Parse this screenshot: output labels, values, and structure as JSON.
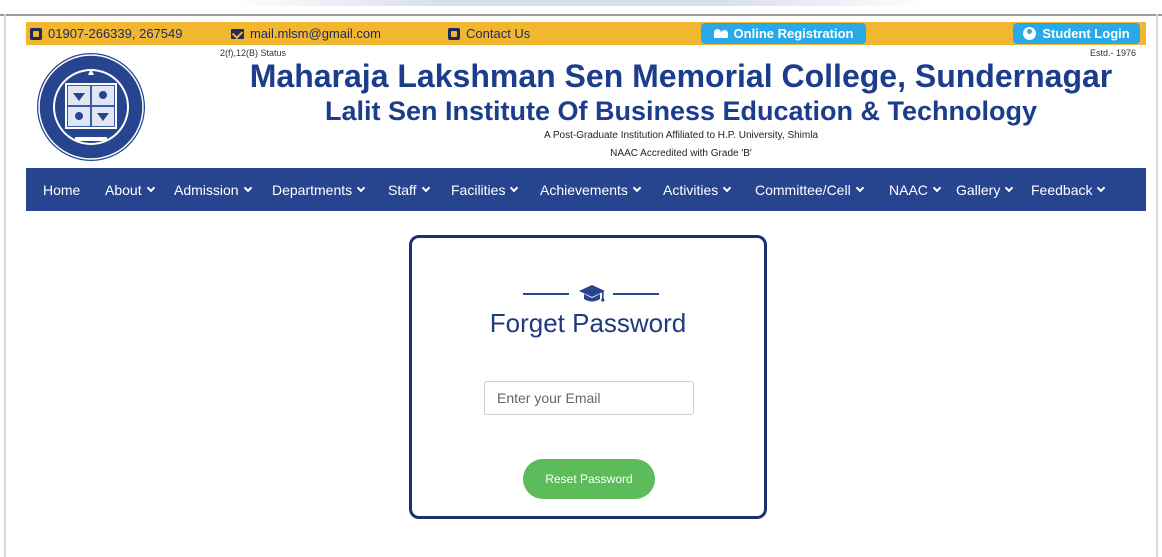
{
  "topbar": {
    "phone": "01907-266339, 267549",
    "email": "mail.mlsm@gmail.com",
    "contact": "Contact Us",
    "registration": "Online Registration",
    "student_login": "Student Login",
    "bg_color": "#f2b730",
    "button_color": "#29a9e8"
  },
  "header": {
    "status": "2(f),12(B) Status",
    "estd": "Estd.- 1976",
    "title": "Maharaja Lakshman Sen Memorial College, Sundernagar",
    "subtitle": "Lalit Sen Institute Of Business Education & Technology",
    "affiliation": "A Post-Graduate Institution Affiliated to H.P. University, Shimla",
    "accreditation": "NAAC Accredited with Grade 'B'",
    "title_color": "#1c3c8c"
  },
  "nav": {
    "bg_color": "#26458e",
    "items": [
      {
        "label": "Home"
      },
      {
        "label": "About"
      },
      {
        "label": "Admission"
      },
      {
        "label": "Departments"
      },
      {
        "label": "Staff"
      },
      {
        "label": "Facilities"
      },
      {
        "label": "Achievements"
      },
      {
        "label": "Activities"
      },
      {
        "label": "Committee/Cell"
      },
      {
        "label": "NAAC"
      },
      {
        "label": "Gallery"
      },
      {
        "label": "Feedback"
      }
    ]
  },
  "form": {
    "title": "Forget Password",
    "icon": "graduation-cap-icon",
    "email_placeholder": "Enter your Email",
    "email_value": "",
    "button": "Reset Password",
    "button_color": "#5cbc5a"
  }
}
